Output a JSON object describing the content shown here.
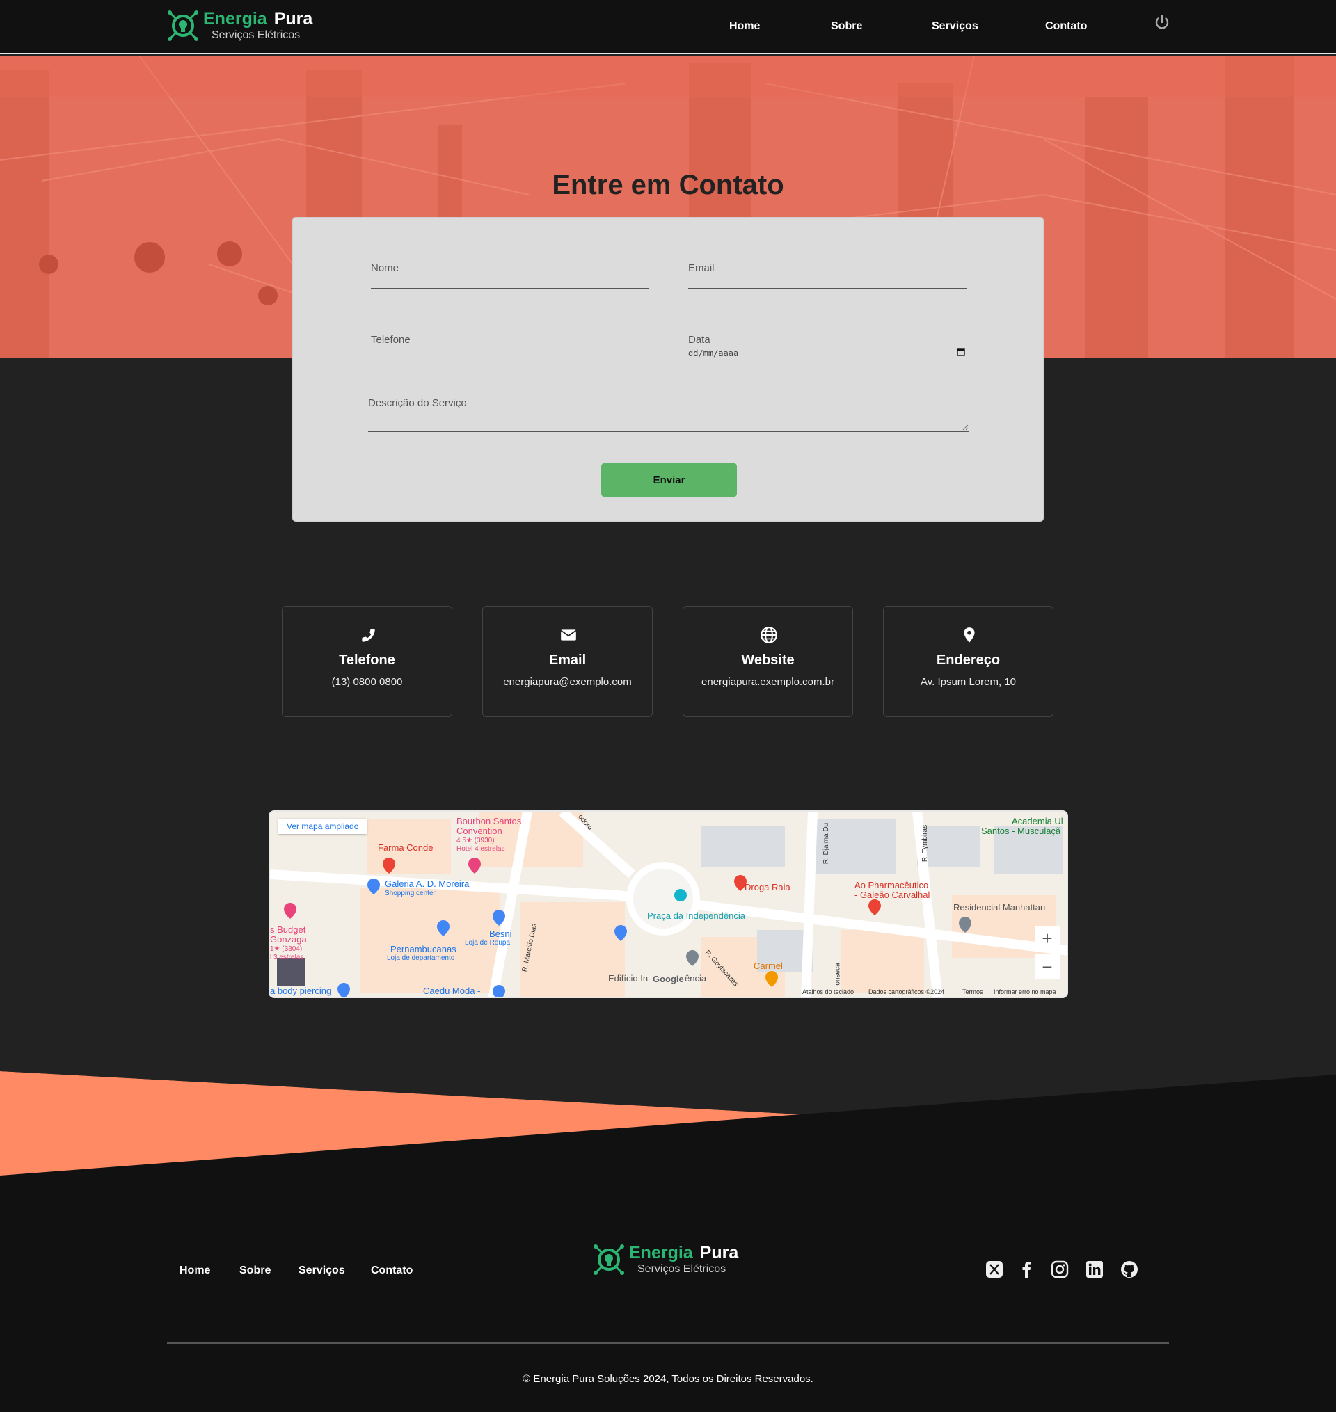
{
  "brand": {
    "name_green": "Energia",
    "name_white": "Pura",
    "tagline": "Serviços Elétricos"
  },
  "nav": {
    "items": [
      "Home",
      "Sobre",
      "Serviços",
      "Contato"
    ]
  },
  "hero": {
    "title": "Entre em Contato"
  },
  "form": {
    "name_label": "Nome",
    "email_label": "Email",
    "phone_label": "Telefone",
    "date_label": "Data",
    "date_placeholder": "dd/mm/aaaa",
    "description_label": "Descrição do Serviço",
    "submit_label": "Enviar"
  },
  "contact_cards": [
    {
      "icon": "phone-icon",
      "title": "Telefone",
      "value": "(13) 0800 0800"
    },
    {
      "icon": "envelope-icon",
      "title": "Email",
      "value": "energiapura@exemplo.com"
    },
    {
      "icon": "globe-icon",
      "title": "Website",
      "value": "energiapura.exemplo.com.br"
    },
    {
      "icon": "location-pin-icon",
      "title": "Endereço",
      "value": "Av. Ipsum Lorem, 10"
    }
  ],
  "map": {
    "enlarge_link": "Ver mapa ampliado",
    "labels": {
      "bourbon": "Bourbon Santos",
      "bourbon2": "Convention",
      "bourbon_rating": "4.5★ (3930)",
      "bourbon_type": "Hotel 4 estrelas",
      "farma": "Farma Conde",
      "galeria": "Galeria A. D. Moreira",
      "galeria_type": "Shopping center",
      "budget": "s Budget",
      "gonzaga": "Gonzaga",
      "budget_rating": "1★ (3304)",
      "budget_stars": "l 3 estrelas",
      "besni": "Besni",
      "besni_type": "Loja de Roupa",
      "pernambucanas": "Pernambucanas",
      "pernambucanas_type": "Loja de departamento",
      "marcilio": "R. Marcílio Dias",
      "praca": "Praça da Independência",
      "droga": "Droga Raia",
      "pharma1": "Ao Pharmacêutico",
      "pharma2": "- Galeão Carvalhal",
      "residencial": "Residencial Manhattan",
      "academia1": "Academia Ul",
      "academia2": "Santos - Musculaçã",
      "carmel": "Carmel",
      "edificio": "Edifício In",
      "edificio2": "ência",
      "goytacazes": "R. Goytacazes",
      "djalma": "R. Djalma Du",
      "tymbiras": "R. Tymbiras",
      "fonseca": "onseca",
      "piercing": "a body piercing",
      "caedu": "Caedu Moda -",
      "odoro": "odoro",
      "google": "Google"
    },
    "footer": {
      "shortcuts": "Atalhos do teclado",
      "data": "Dados cartográficos ©2024",
      "terms": "Termos",
      "report": "Informar erro no mapa"
    },
    "zoom_in": "+",
    "zoom_out": "−"
  },
  "footer": {
    "links": [
      "Home",
      "Sobre",
      "Serviços",
      "Contato"
    ],
    "social": [
      "x-icon",
      "facebook-icon",
      "instagram-icon",
      "linkedin-icon",
      "github-icon"
    ],
    "copyright": "© Energia Pura Soluções 2024, Todos os Direitos Reservados."
  },
  "colors": {
    "accent_green": "#2bb673",
    "hero_overlay": "#e2705e",
    "button_green": "#5cb567",
    "wave_orange": "#ff8a63"
  }
}
